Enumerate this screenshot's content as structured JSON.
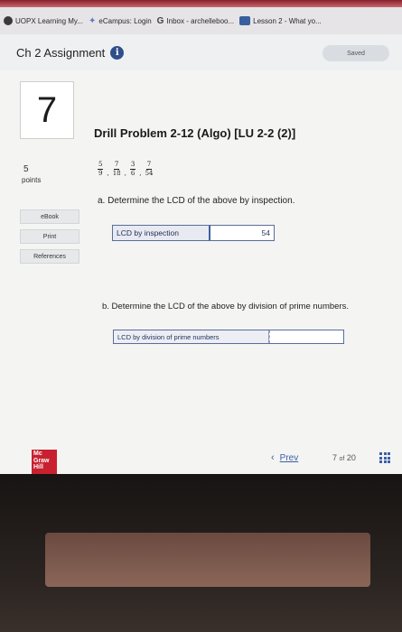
{
  "browser": {
    "bookmarks": [
      {
        "icon": "dark-circle-icon",
        "label": "UOPX Learning My..."
      },
      {
        "icon": "swoosh-icon",
        "label": "eCampus: Login"
      },
      {
        "icon": "g-letter-icon",
        "label": "Inbox - archelleboo..."
      },
      {
        "icon": "lesson-icon",
        "label": "Lesson 2 - What yo..."
      }
    ]
  },
  "assignment": {
    "title": "Ch 2 Assignment",
    "info_icon": "i",
    "saved_label": "Saved"
  },
  "question": {
    "number": "7",
    "title": "Drill Problem 2-12 (Algo) [LU 2-2 (2)]",
    "points_value": "5",
    "points_label": "points",
    "fractions": [
      {
        "num": "5",
        "den": "9"
      },
      {
        "num": "7",
        "den": "18"
      },
      {
        "num": "3",
        "den": "6"
      },
      {
        "num": "7",
        "den": "54"
      }
    ],
    "part_a": "a. Determine the LCD of the above by inspection.",
    "answer_a": {
      "label": "LCD by inspection",
      "value": "54"
    },
    "part_b": "b. Determine the LCD of the above by division of prime numbers.",
    "answer_b": {
      "label": "LCD by division of prime numbers",
      "value": ""
    }
  },
  "side_buttons": [
    "eBook",
    "Print",
    "References"
  ],
  "footer": {
    "logo_text": [
      "Mc",
      "Graw",
      "Hill"
    ],
    "prev_label": "Prev",
    "page_current": "7",
    "page_of": "of",
    "page_total": "20"
  },
  "colors": {
    "accent": "#3a5fa6",
    "logo_red": "#c8202f"
  }
}
